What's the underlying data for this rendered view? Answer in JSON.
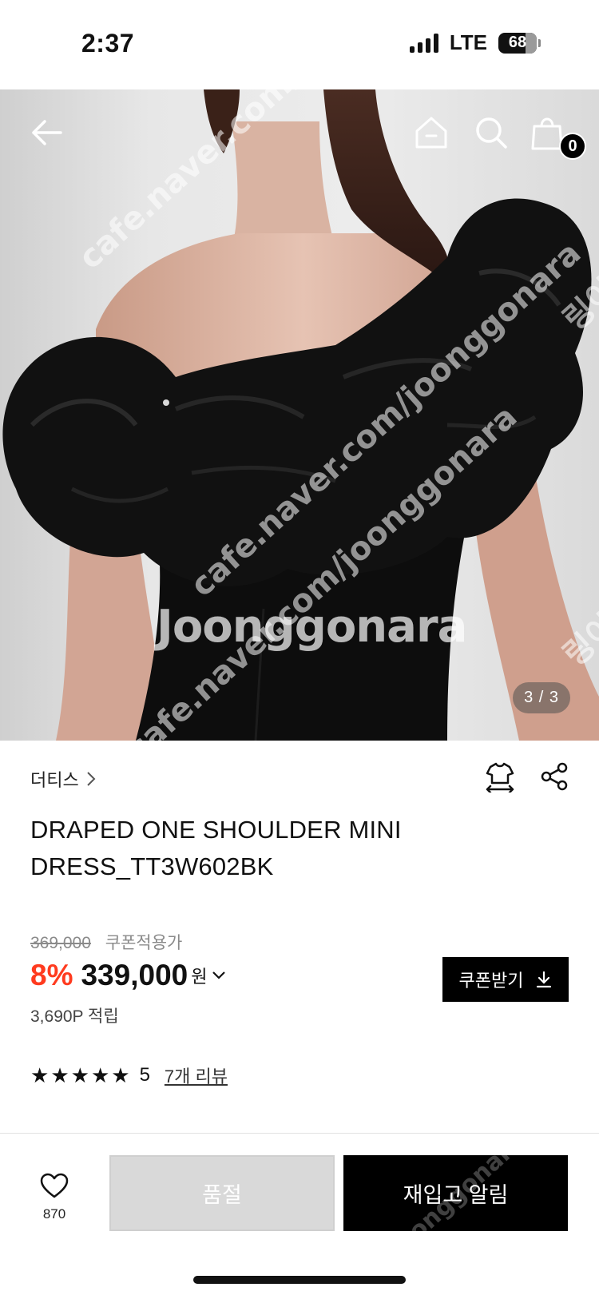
{
  "status_bar": {
    "time": "2:37",
    "network": "LTE",
    "battery": "68"
  },
  "hero": {
    "cart_count": "0",
    "page_indicator": "3 / 3",
    "icons": [
      "back-arrow-icon",
      "home-icon",
      "search-icon",
      "shopping-bag-icon"
    ],
    "watermarks": [
      "cafe.naver.com/joonggonara",
      "Joonggonara",
      "cafe.naver.com/joonggonara",
      "cafe.naver.com/joonggonara",
      "링이",
      "링이"
    ]
  },
  "product": {
    "brand": "더티스",
    "title": "DRAPED ONE SHOULDER MINI DRESS_TT3W602BK",
    "original_price": "369,000",
    "coupon_price_label": "쿠폰적용가",
    "discount": "8%",
    "price": "339,000",
    "currency": "원",
    "coupon_button": "쿠폰받기",
    "points": "3,690P 적립",
    "rating": "5",
    "stars": 5,
    "review_link": "7개 리뷰"
  },
  "bottom_bar": {
    "like_count": "870",
    "soldout_label": "품절",
    "restock_label": "재입고 알림",
    "watermark": "joonggonara"
  },
  "colors": {
    "accent_red": "#ff3b1f",
    "primary_black": "#000000",
    "disabled_gray": "#d9d9d9"
  }
}
